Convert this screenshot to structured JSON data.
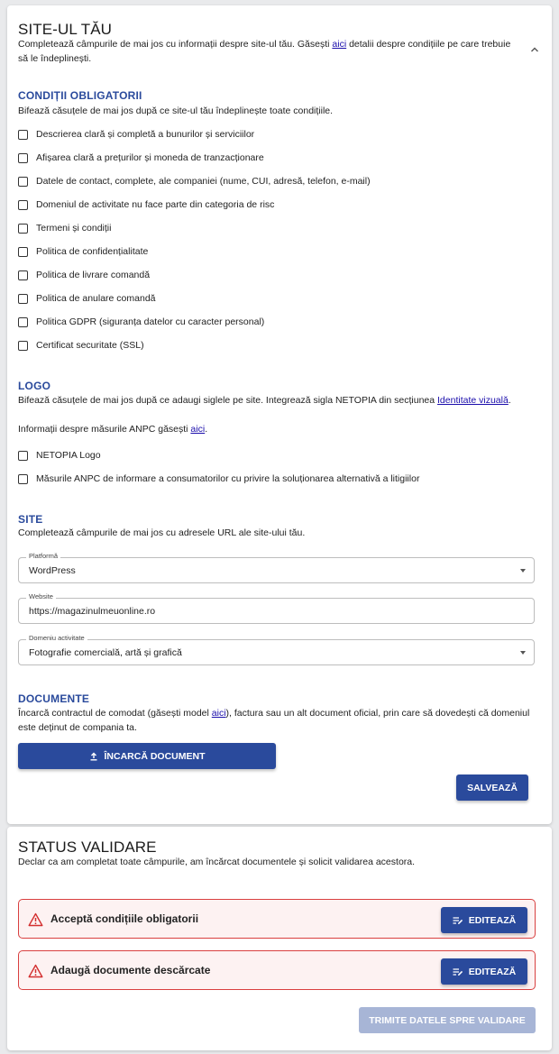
{
  "site": {
    "title": "SITE-UL TĂU",
    "intro_prefix": "Completează câmpurile de mai jos cu informații despre site-ul tău. Găsești ",
    "intro_link": "aici",
    "intro_suffix": " detalii despre condițiile pe care trebuie să le îndeplinești.",
    "toggle_icon": "chevron-up-icon"
  },
  "conditions": {
    "heading": "CONDIȚII OBLIGATORII",
    "description": "Bifează căsuțele de mai jos după ce site-ul tău îndeplinește toate condițiile.",
    "items": [
      {
        "label": "Descrierea clară și completă a bunurilor și serviciilor",
        "checked": false
      },
      {
        "label": "Afișarea clară a prețurilor și moneda de tranzacționare",
        "checked": false
      },
      {
        "label": "Datele de contact, complete, ale companiei (nume, CUI, adresă, telefon, e-mail)",
        "checked": false
      },
      {
        "label": "Domeniul de activitate nu face parte din categoria de risc",
        "checked": false
      },
      {
        "label": "Termeni și condiții",
        "checked": false
      },
      {
        "label": "Politica de confidențialitate",
        "checked": false
      },
      {
        "label": "Politica de livrare comandă",
        "checked": false
      },
      {
        "label": "Politica de anulare comandă",
        "checked": false
      },
      {
        "label": "Politica GDPR (siguranța datelor cu caracter personal)",
        "checked": false
      },
      {
        "label": "Certificat securitate (SSL)",
        "checked": false
      }
    ]
  },
  "logo": {
    "heading": "LOGO",
    "desc_prefix": "Bifează căsuțele de mai jos după ce adaugi siglele pe site. Integrează sigla NETOPIA din secțiunea ",
    "desc_link": "Identitate vizuală",
    "desc_suffix": ".",
    "anpc_prefix": "Informații despre măsurile ANPC găsești ",
    "anpc_link": "aici",
    "anpc_suffix": ".",
    "items": [
      {
        "label": "NETOPIA Logo",
        "checked": false
      },
      {
        "label": "Măsurile ANPC de informare a consumatorilor cu privire la soluționarea alternativă a litigiilor",
        "checked": false
      }
    ]
  },
  "urls": {
    "heading": "SITE",
    "description": "Completează câmpurile de mai jos cu adresele URL ale site-ului tău.",
    "platform_label": "Platformă",
    "platform_value": "WordPress",
    "website_label": "Website",
    "website_value": "https://magazinulmeuonline.ro",
    "domain_label": "Domeniu activitate",
    "domain_value": "Fotografie comercială, artă și grafică"
  },
  "documents": {
    "heading": "DOCUMENTE",
    "desc_prefix": "Încarcă contractul de comodat (găsești model ",
    "desc_link": "aici",
    "desc_suffix": "), factura sau un alt document oficial, prin care să dovedești că domeniul este deținut de compania ta.",
    "upload_label": "ÎNCARCĂ DOCUMENT",
    "upload_icon": "upload-icon",
    "save_label": "SALVEAZĂ"
  },
  "status": {
    "title": "STATUS VALIDARE",
    "description": "Declar ca am completat toate câmpurile, am încărcat documentele și solicit validarea acestora.",
    "alerts": [
      {
        "text": "Acceptă condițiile obligatorii",
        "button": "EDITEAZĂ",
        "icon": "warning-icon"
      },
      {
        "text": "Adaugă documente descărcate",
        "button": "EDITEAZĂ",
        "icon": "warning-icon"
      }
    ],
    "submit_label": "TRIMITE DATELE SPRE VALIDARE",
    "submit_enabled": false
  },
  "colors": {
    "accent": "#2a4a9c",
    "error_border": "#d94040",
    "error_bg": "#fdf2f2",
    "disabled": "#a7b5d6"
  }
}
